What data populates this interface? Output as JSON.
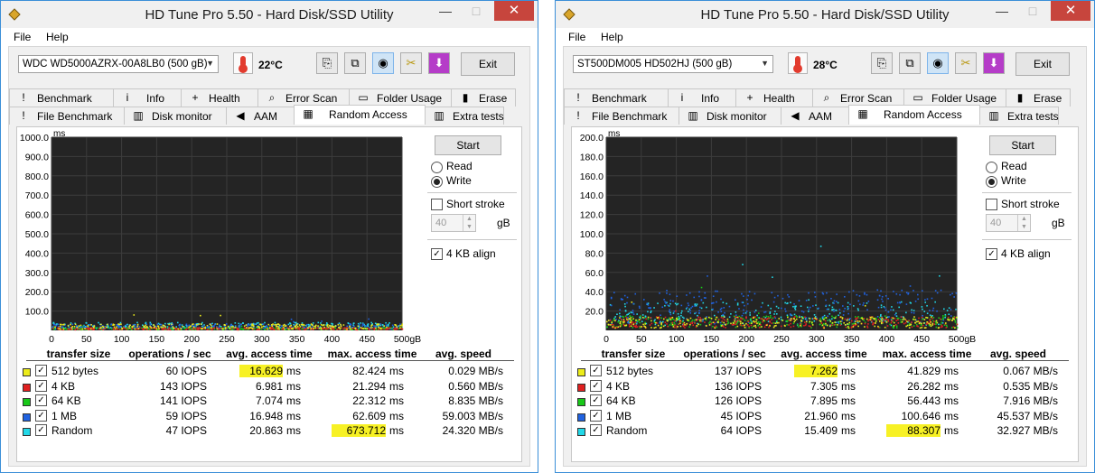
{
  "windows": [
    {
      "title": "HD Tune Pro 5.50 - Hard Disk/SSD Utility",
      "menu": [
        "File",
        "Help"
      ],
      "drive": "WDC WD5000AZRX-00A8LB0 (500 gB)",
      "temperature": "22°C",
      "exit_label": "Exit",
      "tabs_row1": [
        "Benchmark",
        "Info",
        "Health",
        "Error Scan",
        "Folder Usage",
        "Erase"
      ],
      "tabs_row2": [
        "File Benchmark",
        "Disk monitor",
        "AAM",
        "Random Access",
        "Extra tests"
      ],
      "active_tab": "Random Access",
      "controls": {
        "start": "Start",
        "read": "Read",
        "write": "Write",
        "mode": "write",
        "short_stroke": "Short stroke",
        "short_stroke_value": "40",
        "gb": "gB",
        "align": "4 KB align",
        "align_checked": true
      },
      "chart_data": {
        "type": "scatter",
        "ylabel": "ms",
        "ylim": [
          0,
          1000
        ],
        "yticks": [
          "1000.0",
          "900.0",
          "800.0",
          "700.0",
          "600.0",
          "500.0",
          "400.0",
          "300.0",
          "200.0",
          "100.0"
        ],
        "xlim": [
          0,
          500
        ],
        "xticks": [
          "0",
          "50",
          "100",
          "150",
          "200",
          "250",
          "300",
          "350",
          "400",
          "450",
          "500gB"
        ],
        "series": [
          {
            "color": "#e8e81e",
            "typical_ms": 16.629,
            "max_ms": 82.424
          },
          {
            "color": "#e02020",
            "typical_ms": 6.981,
            "max_ms": 21.294
          },
          {
            "color": "#18c818",
            "typical_ms": 7.074,
            "max_ms": 22.312
          },
          {
            "color": "#2062e0",
            "typical_ms": 16.948,
            "max_ms": 62.609
          },
          {
            "color": "#22d8e8",
            "typical_ms": 20.863,
            "max_ms": 673.712
          }
        ]
      },
      "table": {
        "headers": [
          "transfer size",
          "operations / sec",
          "avg. access time",
          "max. access time",
          "avg. speed"
        ],
        "rows": [
          {
            "swatch": "#ecec1a",
            "size": "512 bytes",
            "ops": "60 IOPS",
            "avg": "16.629",
            "max": "82.424",
            "speed": "0.029 MB/s",
            "avg_hl": true,
            "max_hl": false
          },
          {
            "swatch": "#e02020",
            "size": "4 KB",
            "ops": "143 IOPS",
            "avg": "6.981",
            "max": "21.294",
            "speed": "0.560 MB/s",
            "avg_hl": false,
            "max_hl": false
          },
          {
            "swatch": "#18c818",
            "size": "64 KB",
            "ops": "141 IOPS",
            "avg": "7.074",
            "max": "22.312",
            "speed": "8.835 MB/s",
            "avg_hl": false,
            "max_hl": false
          },
          {
            "swatch": "#2062e0",
            "size": "1 MB",
            "ops": "59 IOPS",
            "avg": "16.948",
            "max": "62.609",
            "speed": "59.003 MB/s",
            "avg_hl": false,
            "max_hl": false
          },
          {
            "swatch": "#22d8e8",
            "size": "Random",
            "ops": "47 IOPS",
            "avg": "20.863",
            "max": "673.712",
            "speed": "24.320 MB/s",
            "avg_hl": false,
            "max_hl": true
          }
        ],
        "unit": "ms"
      }
    },
    {
      "title": "HD Tune Pro 5.50 - Hard Disk/SSD Utility",
      "menu": [
        "File",
        "Help"
      ],
      "drive": "ST500DM005 HD502HJ (500 gB)",
      "temperature": "28°C",
      "exit_label": "Exit",
      "tabs_row1": [
        "Benchmark",
        "Info",
        "Health",
        "Error Scan",
        "Folder Usage",
        "Erase"
      ],
      "tabs_row2": [
        "File Benchmark",
        "Disk monitor",
        "AAM",
        "Random Access",
        "Extra tests"
      ],
      "active_tab": "Random Access",
      "controls": {
        "start": "Start",
        "read": "Read",
        "write": "Write",
        "mode": "write",
        "short_stroke": "Short stroke",
        "short_stroke_value": "40",
        "gb": "gB",
        "align": "4 KB align",
        "align_checked": true
      },
      "chart_data": {
        "type": "scatter",
        "ylabel": "ms",
        "ylim": [
          0,
          200
        ],
        "yticks": [
          "200.0",
          "180.0",
          "160.0",
          "140.0",
          "120.0",
          "100.0",
          "80.0",
          "60.0",
          "40.0",
          "20.0"
        ],
        "xlim": [
          0,
          500
        ],
        "xticks": [
          "0",
          "50",
          "100",
          "150",
          "200",
          "250",
          "300",
          "350",
          "400",
          "450",
          "500gB"
        ],
        "series": [
          {
            "color": "#e8e81e",
            "typical_ms": 7.262,
            "max_ms": 41.829
          },
          {
            "color": "#e02020",
            "typical_ms": 7.305,
            "max_ms": 26.282
          },
          {
            "color": "#18c818",
            "typical_ms": 7.895,
            "max_ms": 56.443
          },
          {
            "color": "#2062e0",
            "typical_ms": 21.96,
            "max_ms": 100.646
          },
          {
            "color": "#22d8e8",
            "typical_ms": 15.409,
            "max_ms": 88.307
          }
        ]
      },
      "table": {
        "headers": [
          "transfer size",
          "operations / sec",
          "avg. access time",
          "max. access time",
          "avg. speed"
        ],
        "rows": [
          {
            "swatch": "#ecec1a",
            "size": "512 bytes",
            "ops": "137 IOPS",
            "avg": "7.262",
            "max": "41.829",
            "speed": "0.067 MB/s",
            "avg_hl": true,
            "max_hl": false
          },
          {
            "swatch": "#e02020",
            "size": "4 KB",
            "ops": "136 IOPS",
            "avg": "7.305",
            "max": "26.282",
            "speed": "0.535 MB/s",
            "avg_hl": false,
            "max_hl": false
          },
          {
            "swatch": "#18c818",
            "size": "64 KB",
            "ops": "126 IOPS",
            "avg": "7.895",
            "max": "56.443",
            "speed": "7.916 MB/s",
            "avg_hl": false,
            "max_hl": false
          },
          {
            "swatch": "#2062e0",
            "size": "1 MB",
            "ops": "45 IOPS",
            "avg": "21.960",
            "max": "100.646",
            "speed": "45.537 MB/s",
            "avg_hl": false,
            "max_hl": false
          },
          {
            "swatch": "#22d8e8",
            "size": "Random",
            "ops": "64 IOPS",
            "avg": "15.409",
            "max": "88.307",
            "speed": "32.927 MB/s",
            "avg_hl": false,
            "max_hl": true
          }
        ],
        "unit": "ms"
      }
    }
  ]
}
